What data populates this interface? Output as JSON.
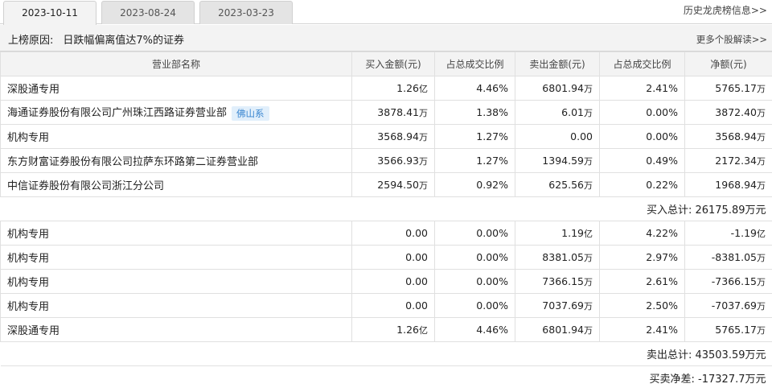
{
  "tabs": [
    {
      "label": "2023-10-11",
      "active": true
    },
    {
      "label": "2023-08-24",
      "active": false
    },
    {
      "label": "2023-03-23",
      "active": false
    }
  ],
  "history_link": "历史龙虎榜信息>>",
  "reason": {
    "label": "上榜原因:",
    "text": "日跌幅偏离值达7%的证券"
  },
  "more_link": "更多个股解读>>",
  "headers": [
    "营业部名称",
    "买入金额(元)",
    "占总成交比例",
    "卖出金额(元)",
    "占总成交比例",
    "净额(元)"
  ],
  "buy_rows": [
    {
      "name": "深股通专用",
      "badge": "",
      "buy": "1.26",
      "buy_unit": "亿",
      "buy_pct": "4.46%",
      "sell": "6801.94",
      "sell_unit": "万",
      "sell_pct": "2.41%",
      "net": "5765.17",
      "net_unit": "万"
    },
    {
      "name": "海通证券股份有限公司广州珠江西路证券营业部",
      "badge": "佛山系",
      "buy": "3878.41",
      "buy_unit": "万",
      "buy_pct": "1.38%",
      "sell": "6.01",
      "sell_unit": "万",
      "sell_pct": "0.00%",
      "net": "3872.40",
      "net_unit": "万"
    },
    {
      "name": "机构专用",
      "badge": "",
      "buy": "3568.94",
      "buy_unit": "万",
      "buy_pct": "1.27%",
      "sell": "0.00",
      "sell_unit": "",
      "sell_pct": "0.00%",
      "net": "3568.94",
      "net_unit": "万"
    },
    {
      "name": "东方财富证券股份有限公司拉萨东环路第二证券营业部",
      "badge": "",
      "buy": "3566.93",
      "buy_unit": "万",
      "buy_pct": "1.27%",
      "sell": "1394.59",
      "sell_unit": "万",
      "sell_pct": "0.49%",
      "net": "2172.34",
      "net_unit": "万"
    },
    {
      "name": "中信证券股份有限公司浙江分公司",
      "badge": "",
      "buy": "2594.50",
      "buy_unit": "万",
      "buy_pct": "0.92%",
      "sell": "625.56",
      "sell_unit": "万",
      "sell_pct": "0.22%",
      "net": "1968.94",
      "net_unit": "万"
    }
  ],
  "buy_total": {
    "label": "买入总计:",
    "value": "26175.89万元"
  },
  "sell_rows": [
    {
      "name": "机构专用",
      "badge": "",
      "buy": "0.00",
      "buy_unit": "",
      "buy_pct": "0.00%",
      "sell": "1.19",
      "sell_unit": "亿",
      "sell_pct": "4.22%",
      "net": "-1.19",
      "net_unit": "亿"
    },
    {
      "name": "机构专用",
      "badge": "",
      "buy": "0.00",
      "buy_unit": "",
      "buy_pct": "0.00%",
      "sell": "8381.05",
      "sell_unit": "万",
      "sell_pct": "2.97%",
      "net": "-8381.05",
      "net_unit": "万"
    },
    {
      "name": "机构专用",
      "badge": "",
      "buy": "0.00",
      "buy_unit": "",
      "buy_pct": "0.00%",
      "sell": "7366.15",
      "sell_unit": "万",
      "sell_pct": "2.61%",
      "net": "-7366.15",
      "net_unit": "万"
    },
    {
      "name": "机构专用",
      "badge": "",
      "buy": "0.00",
      "buy_unit": "",
      "buy_pct": "0.00%",
      "sell": "7037.69",
      "sell_unit": "万",
      "sell_pct": "2.50%",
      "net": "-7037.69",
      "net_unit": "万"
    },
    {
      "name": "深股通专用",
      "badge": "",
      "buy": "1.26",
      "buy_unit": "亿",
      "buy_pct": "4.46%",
      "sell": "6801.94",
      "sell_unit": "万",
      "sell_pct": "2.41%",
      "net": "5765.17",
      "net_unit": "万"
    }
  ],
  "sell_total": {
    "label": "卖出总计:",
    "value": "43503.59万元"
  },
  "net_total": {
    "label": "买卖净差:",
    "value": "-17327.7万元"
  }
}
